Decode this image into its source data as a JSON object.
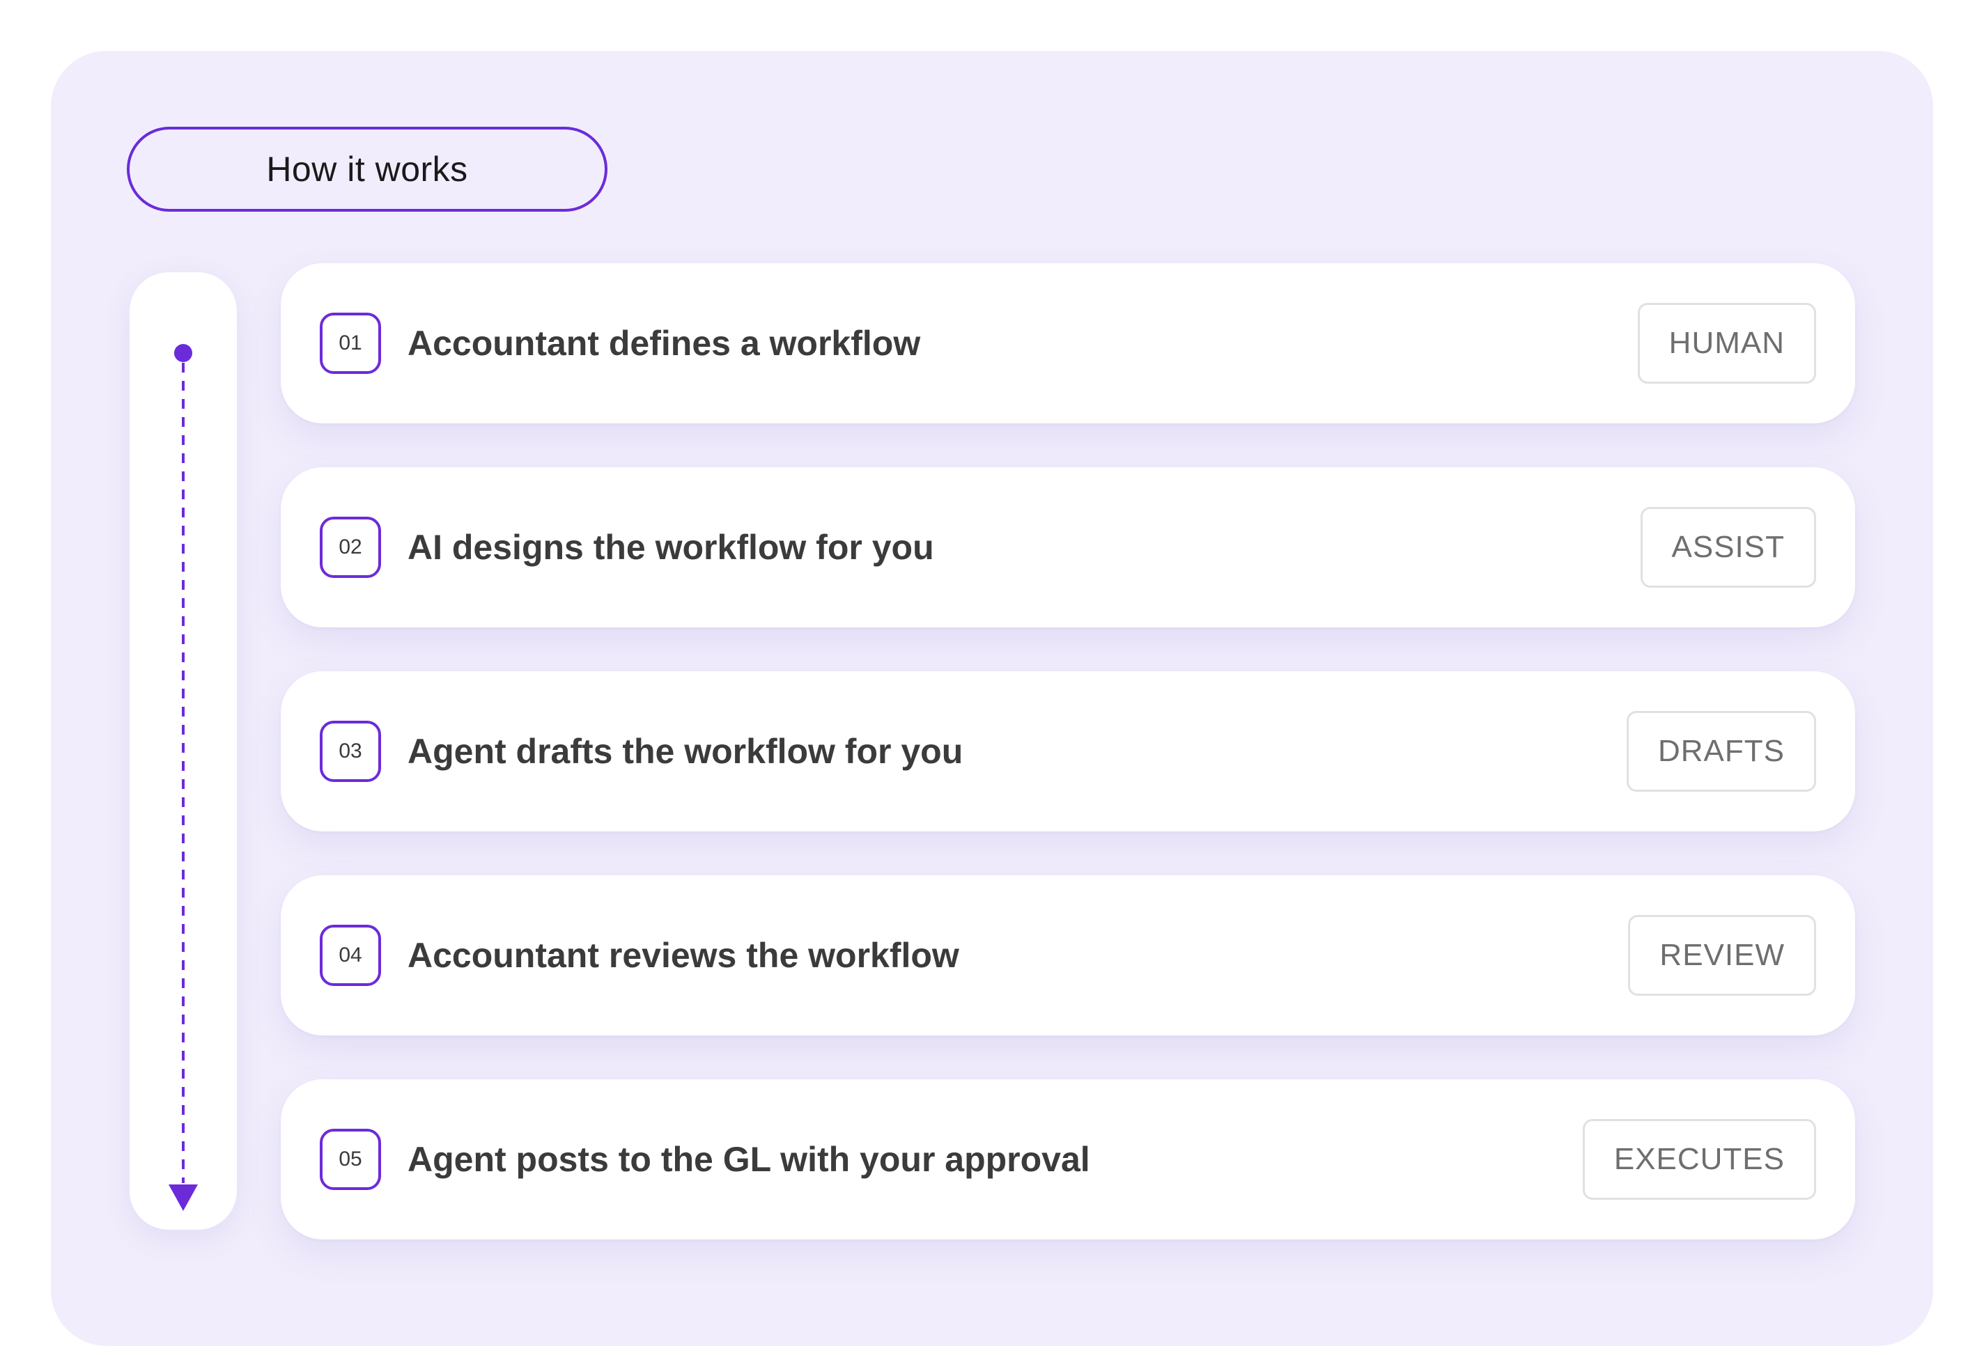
{
  "header": {
    "label": "How it works"
  },
  "steps": [
    {
      "number": "01",
      "title": "Accountant defines a workflow",
      "tag": "HUMAN"
    },
    {
      "number": "02",
      "title": "AI designs the workflow for you",
      "tag": "ASSIST"
    },
    {
      "number": "03",
      "title": "Agent drafts the workflow for you",
      "tag": "DRAFTS"
    },
    {
      "number": "04",
      "title": "Accountant reviews the workflow",
      "tag": "REVIEW"
    },
    {
      "number": "05",
      "title": "Agent posts to the GL with your approval",
      "tag": "EXECUTES"
    }
  ],
  "icons": {
    "timeline_start": "dot-icon",
    "timeline_end": "arrow-down-icon"
  },
  "colors": {
    "accent": "#6c2bd9",
    "panel_background": "#f1edfc",
    "card_background": "#ffffff",
    "title_text": "#3b3b3b",
    "tag_text": "#6e6e6e",
    "tag_border": "#e1e1e1"
  }
}
